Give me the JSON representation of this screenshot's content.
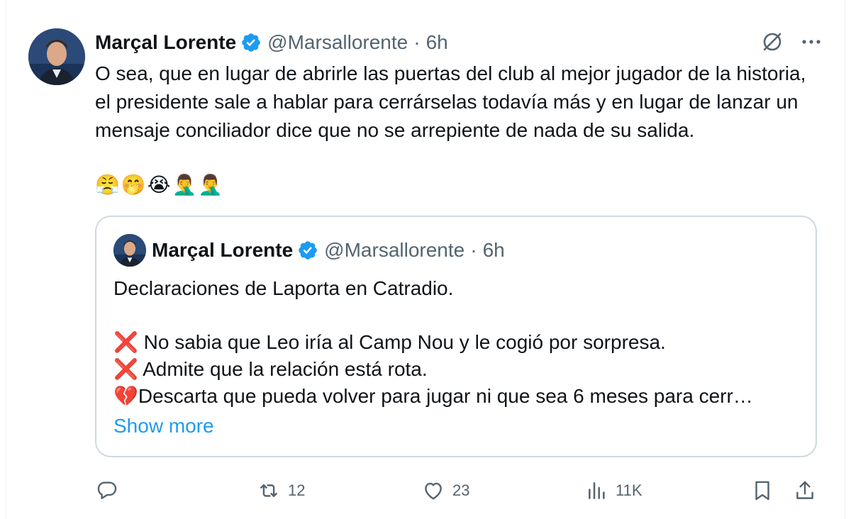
{
  "tweet": {
    "author_name": "Marçal Lorente",
    "handle": "@Marsallorente",
    "separator": "·",
    "time": "6h",
    "text": "O sea, que en lugar de abrirle las puertas del club al mejor jugador de la historia, el presidente sale a hablar para cerrárselas todavía más y en lugar de lanzar un mensaje conciliador dice que no se arrepiente de nada de su salida.",
    "emojis": "😤🤭😭🤦‍♂️🤦‍♂️",
    "grok_icon": "slash-circle-icon",
    "more_icon": "more-dots-icon"
  },
  "quote": {
    "author_name": "Marçal Lorente",
    "handle": "@Marsallorente",
    "separator": "·",
    "time": "6h",
    "line1": "Declaraciones de Laporta en Catradio.",
    "line2": "❌ No sabia que Leo iría al Camp Nou y le cogió por sorpresa.",
    "line3": "❌ Admite que la relación está rota.",
    "line4": "💔Descarta que pueda volver para jugar ni que sea 6 meses para cerr…",
    "show_more": "Show more"
  },
  "actions": {
    "reply_count": "",
    "retweet_count": "12",
    "like_count": "23",
    "views_count": "11K"
  },
  "colors": {
    "verified": "#1d9bf0",
    "link": "#1d9bf0",
    "muted": "#536471",
    "border": "#cfd9de"
  }
}
